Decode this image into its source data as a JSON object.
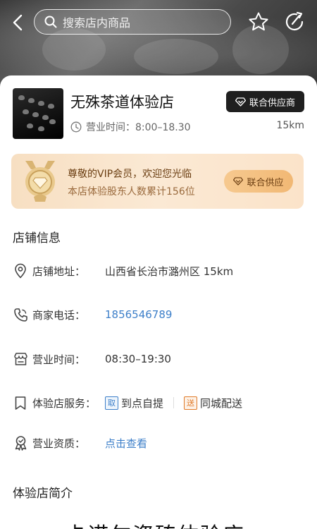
{
  "header": {
    "search_placeholder": "搜索店内商品"
  },
  "store": {
    "name": "无殊茶道体验店",
    "badge": "联合供应商",
    "hours_label": "营业时间：8:00–18.30",
    "distance": "15km"
  },
  "vip": {
    "title": "尊敬的VIP会员，欢迎您光临",
    "subtitle": "本店体验股东人数累计156位",
    "button": "联合供应"
  },
  "shop_info": {
    "title": "店铺信息",
    "rows": [
      {
        "label": "店铺地址：",
        "value": "山西省长治市潞州区 15km"
      },
      {
        "label": "商家电话：",
        "value": "1856546789"
      },
      {
        "label": "营业时间：",
        "value": "08:30–19:30"
      },
      {
        "label": "体验店服务：",
        "services": [
          {
            "tag": "取",
            "text": "到点自提"
          },
          {
            "tag": "送",
            "text": "同城配送"
          }
        ]
      },
      {
        "label": "营业资质：",
        "value": "点击查看"
      }
    ]
  },
  "intro": {
    "title": "体验店简介",
    "heading": "卡诺尔瓷砖体验店"
  },
  "colors": {
    "link": "#3d7fc9",
    "badge_bg": "#1f1f1f",
    "vip_text": "#6b3e12",
    "orange_tag": "#e07b2a"
  }
}
